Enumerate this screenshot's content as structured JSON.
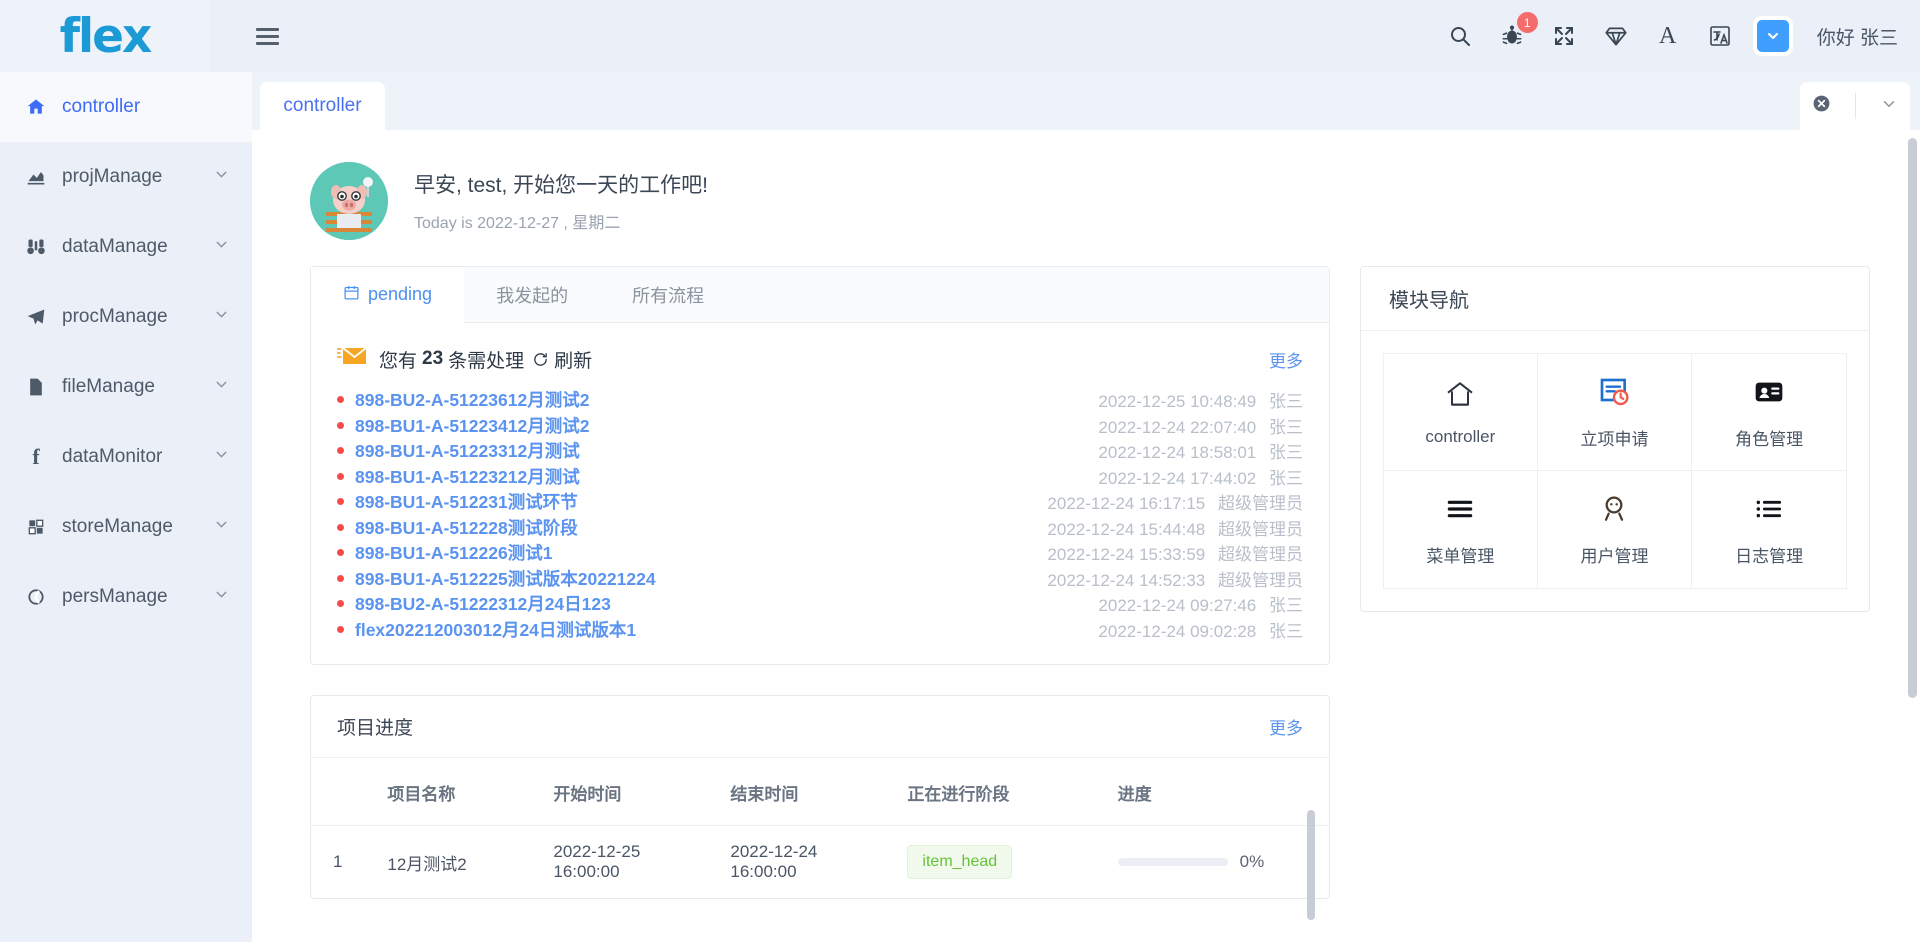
{
  "header": {
    "logo_text": "flex",
    "username": "你好 张三",
    "icons": [
      {
        "name": "search-icon"
      },
      {
        "name": "bug-icon",
        "badge": "1"
      },
      {
        "name": "fullscreen-icon"
      },
      {
        "name": "theme-diamond-icon"
      },
      {
        "name": "font-size-icon",
        "glyph": "A"
      },
      {
        "name": "translate-icon"
      },
      {
        "name": "dropdown-toggle-icon"
      }
    ]
  },
  "sidebar": {
    "items": [
      {
        "label": "controller",
        "icon": "home-icon",
        "active": true,
        "expandable": false
      },
      {
        "label": "projManage",
        "icon": "chart-icon",
        "active": false,
        "expandable": true
      },
      {
        "label": "dataManage",
        "icon": "binoculars-icon",
        "active": false,
        "expandable": true
      },
      {
        "label": "procManage",
        "icon": "paper-plane-icon",
        "active": false,
        "expandable": true
      },
      {
        "label": "fileManage",
        "icon": "file-icon",
        "active": false,
        "expandable": true
      },
      {
        "label": "dataMonitor",
        "icon": "f-letter-icon",
        "active": false,
        "expandable": true
      },
      {
        "label": "storeManage",
        "icon": "grid-square-icon",
        "active": false,
        "expandable": true
      },
      {
        "label": "persManage",
        "icon": "circle-icon",
        "active": false,
        "expandable": true
      }
    ]
  },
  "tabbar": {
    "tabs": [
      {
        "label": "controller",
        "active": true
      }
    ]
  },
  "greeting": {
    "title": "早安, test, 开始您一天的工作吧!",
    "subtitle": "Today is 2022-12-27 , 星期二"
  },
  "pending": {
    "tabs": [
      {
        "label": "pending",
        "active": true,
        "icon": "calendar-icon"
      },
      {
        "label": "我发起的",
        "active": false
      },
      {
        "label": "所有流程",
        "active": false
      }
    ],
    "notice_prefix": "您有",
    "notice_count": "23",
    "notice_suffix": "条需处理",
    "refresh_label": "刷新",
    "more_label": "更多",
    "tasks": [
      {
        "name": "898-BU2-A-51223612月测试2",
        "time": "2022-12-25 10:48:49",
        "who": "张三"
      },
      {
        "name": "898-BU1-A-51223412月测试2",
        "time": "2022-12-24 22:07:40",
        "who": "张三"
      },
      {
        "name": "898-BU1-A-51223312月测试",
        "time": "2022-12-24 18:58:01",
        "who": "张三"
      },
      {
        "name": "898-BU1-A-51223212月测试",
        "time": "2022-12-24 17:44:02",
        "who": "张三"
      },
      {
        "name": "898-BU1-A-512231测试环节",
        "time": "2022-12-24 16:17:15",
        "who": "超级管理员"
      },
      {
        "name": "898-BU1-A-512228测试阶段",
        "time": "2022-12-24 15:44:48",
        "who": "超级管理员"
      },
      {
        "name": "898-BU1-A-512226测试1",
        "time": "2022-12-24 15:33:59",
        "who": "超级管理员"
      },
      {
        "name": "898-BU1-A-512225测试版本20221224",
        "time": "2022-12-24 14:52:33",
        "who": "超级管理员"
      },
      {
        "name": "898-BU2-A-51222312月24日123",
        "time": "2022-12-24 09:27:46",
        "who": "张三"
      },
      {
        "name": "flex202212003012月24日测试版本1",
        "time": "2022-12-24 09:02:28",
        "who": "张三"
      }
    ]
  },
  "project_progress": {
    "title": "项目进度",
    "more_label": "更多",
    "columns": [
      "",
      "项目名称",
      "开始时间",
      "结束时间",
      "正在进行阶段",
      "进度"
    ],
    "rows": [
      {
        "index": "1",
        "name": "12月测试2",
        "start": "2022-12-25 16:00:00",
        "end": "2022-12-24 16:00:00",
        "stage": "item_head",
        "progress": "0%"
      }
    ]
  },
  "module_nav": {
    "title": "模块导航",
    "items": [
      {
        "label": "controller",
        "icon": "home-outline-icon"
      },
      {
        "label": "立项申请",
        "icon": "document-clock-icon"
      },
      {
        "label": "角色管理",
        "icon": "id-card-icon"
      },
      {
        "label": "菜单管理",
        "icon": "menu-lines-icon"
      },
      {
        "label": "用户管理",
        "icon": "user-face-icon"
      },
      {
        "label": "日志管理",
        "icon": "list-icon"
      }
    ]
  },
  "colors": {
    "brand_blue": "#1c9ad6",
    "link_blue": "#5a93f0",
    "badge_red": "#f56c6c",
    "accent_button": "#409eff",
    "stage_green": "#67c23a",
    "bullet_red": "#f54b4b"
  }
}
